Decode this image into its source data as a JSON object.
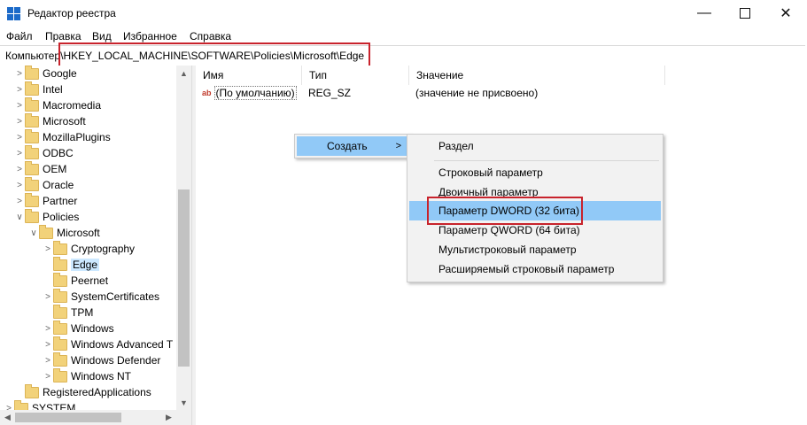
{
  "window": {
    "title": "Редактор реестра",
    "minimize_icon": "minimize-icon",
    "maximize_icon": "maximize-icon",
    "close_icon": "close-icon"
  },
  "menu": [
    "Файл",
    "Правка",
    "Вид",
    "Избранное",
    "Справка"
  ],
  "address": {
    "path": "Компьютер\\HKEY_LOCAL_MACHINE\\SOFTWARE\\Policies\\Microsoft\\Edge"
  },
  "tree": {
    "items": [
      {
        "label": "Google"
      },
      {
        "label": "Intel"
      },
      {
        "label": "Macromedia"
      },
      {
        "label": "Microsoft"
      },
      {
        "label": "MozillaPlugins"
      },
      {
        "label": "ODBC"
      },
      {
        "label": "OEM"
      },
      {
        "label": "Oracle"
      },
      {
        "label": "Partner"
      },
      {
        "label": "Policies"
      },
      {
        "label": "Microsoft"
      },
      {
        "label": "Cryptography"
      },
      {
        "label": "Edge"
      },
      {
        "label": "Peernet"
      },
      {
        "label": "SystemCertificates"
      },
      {
        "label": "TPM"
      },
      {
        "label": "Windows"
      },
      {
        "label": "Windows Advanced T"
      },
      {
        "label": "Windows Defender"
      },
      {
        "label": "Windows NT"
      },
      {
        "label": "RegisteredApplications"
      },
      {
        "label": "SYSTEM"
      }
    ]
  },
  "list": {
    "headers": {
      "name": "Имя",
      "type": "Тип",
      "value": "Значение"
    },
    "rows": [
      {
        "name": "(По умолчанию)",
        "type": "REG_SZ",
        "value": "(значение не присвоено)"
      }
    ]
  },
  "context_menu": {
    "create_label": "Создать"
  },
  "submenu": {
    "items": [
      "Раздел",
      "Строковый параметр",
      "Двоичный параметр",
      "Параметр DWORD (32 бита)",
      "Параметр QWORD (64 бита)",
      "Мультистроковый параметр",
      "Расширяемый строковый параметр"
    ],
    "highlighted_index": 3
  },
  "colors": {
    "highlight": "#91c9f7",
    "annotation": "#c8232c",
    "folder": "#f2d27a"
  }
}
